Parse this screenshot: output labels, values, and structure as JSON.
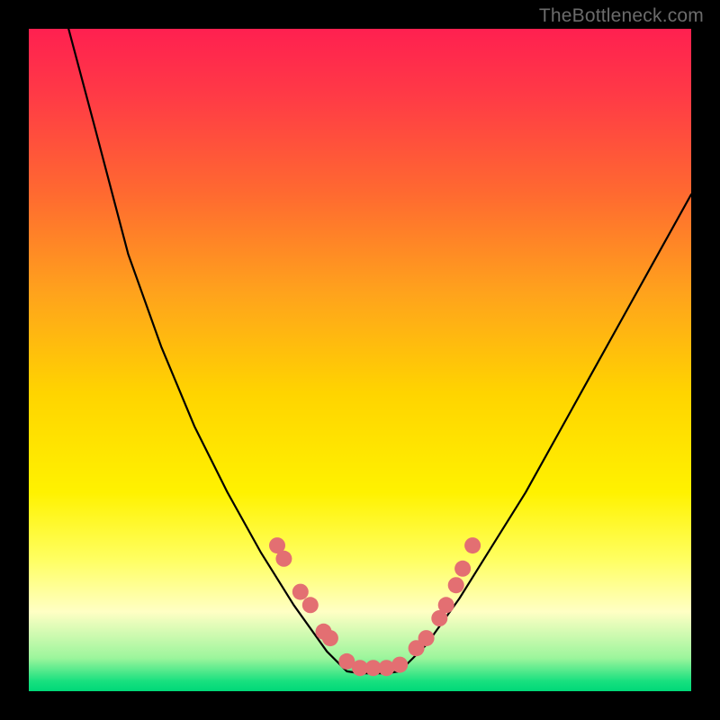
{
  "watermark": "TheBottleneck.com",
  "gradient": {
    "stops": [
      {
        "offset": 0.0,
        "color": "#ff2050"
      },
      {
        "offset": 0.1,
        "color": "#ff3a46"
      },
      {
        "offset": 0.25,
        "color": "#ff6a30"
      },
      {
        "offset": 0.4,
        "color": "#ffa31c"
      },
      {
        "offset": 0.55,
        "color": "#ffd400"
      },
      {
        "offset": 0.7,
        "color": "#fff200"
      },
      {
        "offset": 0.8,
        "color": "#ffff60"
      },
      {
        "offset": 0.88,
        "color": "#ffffc4"
      },
      {
        "offset": 0.95,
        "color": "#9cf59c"
      },
      {
        "offset": 0.985,
        "color": "#18e07f"
      },
      {
        "offset": 1.0,
        "color": "#00d878"
      }
    ]
  },
  "chart_data": {
    "type": "line",
    "title": "",
    "xlabel": "",
    "ylabel": "",
    "xlim": [
      0,
      100
    ],
    "ylim": [
      0,
      100
    ],
    "series": [
      {
        "name": "bottleneck-curve-left",
        "x": [
          6,
          10,
          15,
          20,
          25,
          30,
          35,
          40,
          45,
          48
        ],
        "y": [
          100,
          85,
          66,
          52,
          40,
          30,
          21,
          13,
          6,
          3
        ]
      },
      {
        "name": "bottleneck-curve-flat",
        "x": [
          48,
          50,
          52,
          54,
          56
        ],
        "y": [
          3,
          2.7,
          2.7,
          2.7,
          3
        ]
      },
      {
        "name": "bottleneck-curve-right",
        "x": [
          56,
          60,
          65,
          70,
          75,
          80,
          85,
          90,
          95,
          100
        ],
        "y": [
          3,
          7,
          14,
          22,
          30,
          39,
          48,
          57,
          66,
          75
        ]
      }
    ],
    "markers": {
      "name": "benchmark-points",
      "color": "#e36f72",
      "radius": 9,
      "points": [
        {
          "x": 37.5,
          "y": 22
        },
        {
          "x": 38.5,
          "y": 20
        },
        {
          "x": 41,
          "y": 15
        },
        {
          "x": 42.5,
          "y": 13
        },
        {
          "x": 44.5,
          "y": 9
        },
        {
          "x": 45.5,
          "y": 8
        },
        {
          "x": 48,
          "y": 4.5
        },
        {
          "x": 50,
          "y": 3.5
        },
        {
          "x": 52,
          "y": 3.5
        },
        {
          "x": 54,
          "y": 3.5
        },
        {
          "x": 56,
          "y": 4
        },
        {
          "x": 58.5,
          "y": 6.5
        },
        {
          "x": 60,
          "y": 8
        },
        {
          "x": 62,
          "y": 11
        },
        {
          "x": 63,
          "y": 13
        },
        {
          "x": 64.5,
          "y": 16
        },
        {
          "x": 65.5,
          "y": 18.5
        },
        {
          "x": 67,
          "y": 22
        }
      ]
    }
  }
}
